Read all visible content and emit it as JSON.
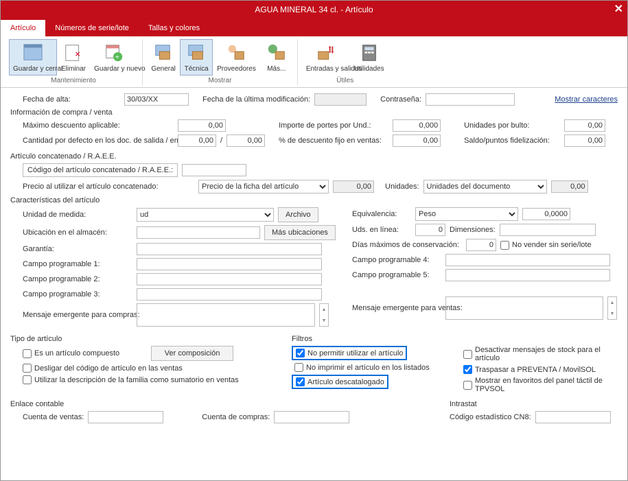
{
  "window": {
    "title": "AGUA MINERAL 34 cl. - Artículo"
  },
  "tabs": {
    "t1": "Artículo",
    "t2": "Números de serie/lote",
    "t3": "Tallas y colores"
  },
  "ribbon": {
    "save": "Guardar y cerrar",
    "del": "Eliminar",
    "savenew": "Guardar y nuevo",
    "g1": "Mantenimiento",
    "general": "General",
    "tecnica": "Técnica",
    "prov": "Proveedores",
    "mas": "Más...",
    "g2": "Mostrar",
    "entradas": "Entradas y salidas",
    "util": "Utilidades",
    "g3": "Útiles"
  },
  "f": {
    "fecha_alta": "Fecha de alta:",
    "fecha_alta_v": "30/03/XX",
    "fecha_mod": "Fecha de la última modificación:",
    "contrasena": "Contraseña:",
    "mostrar": "Mostrar caracteres",
    "info": "Información de compra / venta",
    "max_desc": "Máximo descuento aplicable:",
    "max_desc_v": "0,00",
    "cant_def": "Cantidad por defecto en los doc. de salida / entrada:",
    "cant_def_v1": "0,00",
    "cant_def_v2": "0,00",
    "sep": "/",
    "importe": "Importe de portes por Und.:",
    "importe_v": "0,000",
    "pct": "% de descuento fijo en ventas:",
    "pct_v": "0,00",
    "uxb": "Unidades por bulto:",
    "uxb_v": "0,00",
    "saldo": "Saldo/puntos fidelización:",
    "saldo_v": "0,00",
    "concat": "Artículo concatenado / R.A.E.E.",
    "concat_code": "Código del artículo concatenado / R.A.E.E.:",
    "precio_util": "Precio al utilizar el artículo concatenado:",
    "precio_sel": "Precio de la ficha del artículo",
    "precio_v": "0,00",
    "unidades": "Unidades:",
    "unidades_sel": "Unidades del documento",
    "unidades_v": "0,00",
    "caract": "Características del artículo",
    "um": "Unidad de medida:",
    "um_v": "ud",
    "archivo": "Archivo",
    "equiv": "Equivalencia:",
    "equiv_sel": "Peso",
    "equiv_v": "0,0000",
    "ubic": "Ubicación en el almacén:",
    "masubic": "Más ubicaciones",
    "udslinea": "Uds. en línea:",
    "udslinea_v": "0",
    "dims": "Dimensiones:",
    "garantia": "Garantía:",
    "diasmax": "Días máximos de conservación:",
    "diasmax_v": "0",
    "nolote": "No vender sin serie/lote",
    "cp1": "Campo programable 1:",
    "cp2": "Campo programable 2:",
    "cp3": "Campo programable 3:",
    "cp4": "Campo programable 4:",
    "cp5": "Campo programable 5:",
    "memc": "Mensaje emergente para compras:",
    "memv": "Mensaje emergente para ventas:",
    "tipo": "Tipo de artículo",
    "filtros": "Filtros",
    "compuesto": "Es un artículo compuesto",
    "vercomp": "Ver composición",
    "desligar": "Desligar del código de artículo en las ventas",
    "usardesc": "Utilizar la descripción de la familia como sumatorio en ventas",
    "nopermitir": "No permitir utilizar el artículo",
    "noimprimir": "No imprimir el artículo en los listados",
    "descatalogado": "Artículo descatalogado",
    "desactivar": "Desactivar mensajes de stock para el artículo",
    "traspasar": "Traspasar a PREVENTA / MovilSOL",
    "favoritos": "Mostrar en favoritos del panel táctil de TPVSOL",
    "enlace": "Enlace contable",
    "intrastat": "Intrastat",
    "cventas": "Cuenta de ventas:",
    "ccompras": "Cuenta de compras:",
    "cn8": "Código estadístico CN8:"
  }
}
